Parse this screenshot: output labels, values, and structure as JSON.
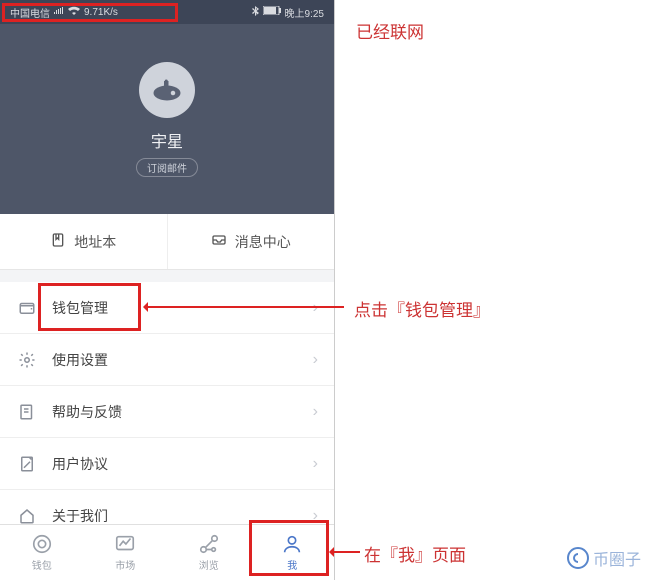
{
  "status": {
    "carrier": "中国电信",
    "speed": "9.71K/s",
    "time": "晚上9:25"
  },
  "hero": {
    "username": "宇星",
    "subscribe_label": "订阅邮件"
  },
  "quick": {
    "address_book": "地址本",
    "message_center": "消息中心"
  },
  "list": {
    "wallet_manage": "钱包管理",
    "settings": "使用设置",
    "help": "帮助与反馈",
    "agreement": "用户协议",
    "about": "关于我们"
  },
  "tabs": {
    "wallet": "钱包",
    "market": "市场",
    "browse": "浏览",
    "me": "我"
  },
  "annotations": {
    "networked": "已经联网",
    "click_wallet": "点击『钱包管理』",
    "on_me_page": "在『我』页面"
  },
  "watermark": "币圈子"
}
